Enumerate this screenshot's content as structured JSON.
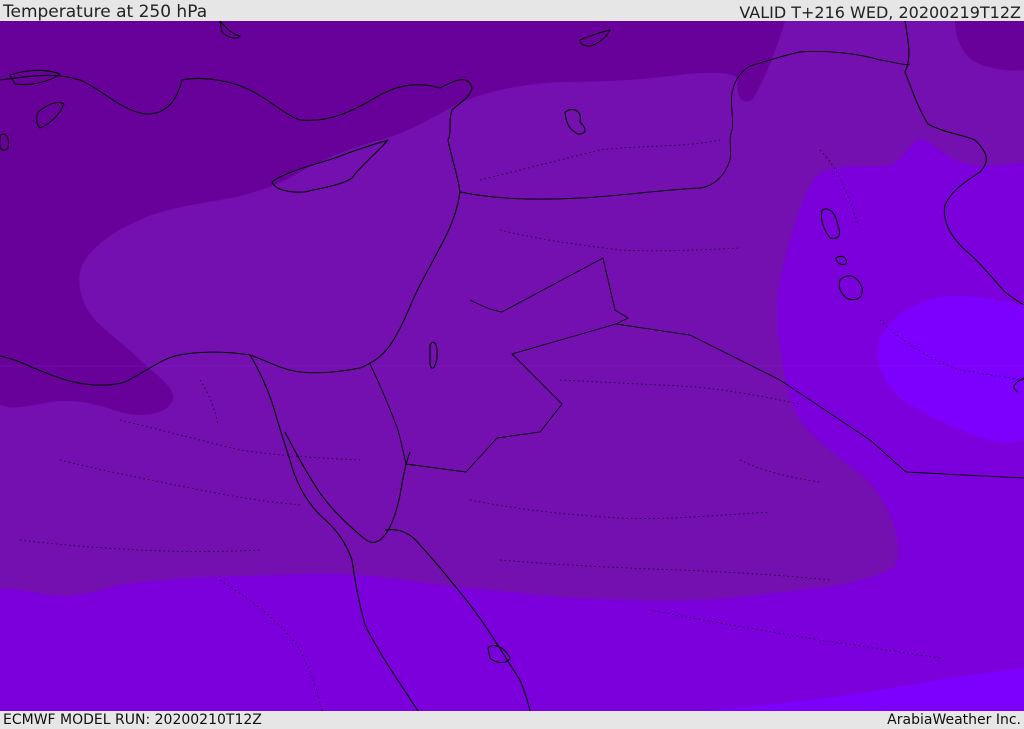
{
  "header": {
    "title": "Temperature at 250 hPa",
    "valid": "VALID T+216 WED, 20200219T12Z"
  },
  "footer": {
    "model_run": "ECMWF MODEL RUN: 20200210T12Z",
    "credit": "ArabiaWeather Inc."
  },
  "colors": {
    "band_darkest": "#68009a",
    "band_dark": "#7410b0",
    "band_mid": "#7c00dc",
    "band_light": "#7d00ff",
    "bar_background": "#e6e6e6",
    "coastline": "#000000"
  }
}
